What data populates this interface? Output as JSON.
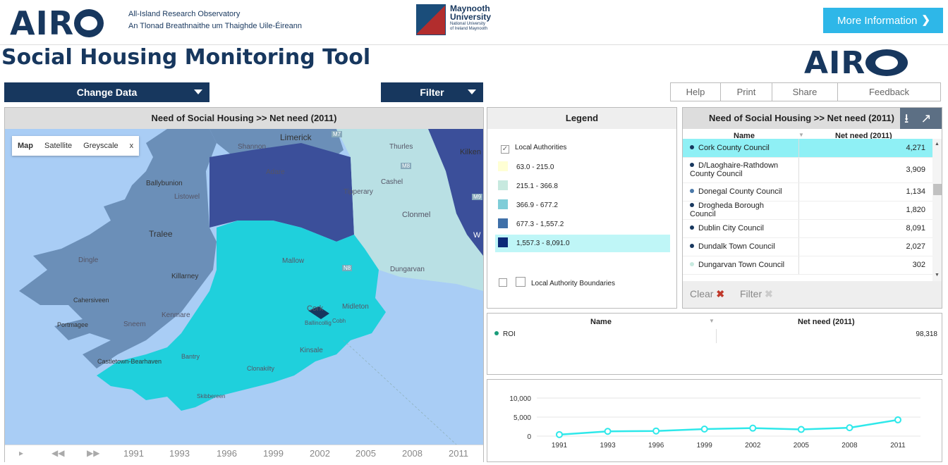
{
  "header": {
    "logo_text": "AIRO",
    "org_line1": "All-Island Research Observatory",
    "org_line2": "An Tlonad Breathnaithe um Thaighde Uile-Éireann",
    "university_name_line1": "Maynooth",
    "university_name_line2": "University",
    "university_sub_line1": "National University",
    "university_sub_line2": "of Ireland Maynooth",
    "more_info_label": "More Information",
    "more_info_icon": "chevron-right-icon"
  },
  "page_title": "Social Housing Monitoring Tool",
  "toolbar": {
    "change_data_label": "Change Data",
    "filter_label": "Filter",
    "help_label": "Help",
    "print_label": "Print",
    "share_label": "Share",
    "feedback_label": "Feedback"
  },
  "map_panel": {
    "title": "Need of Social Housing >>  Net need (2011)",
    "map_types": [
      "Map",
      "Satellite",
      "Greyscale",
      "x"
    ],
    "places": {
      "shannon": "Shannon",
      "limerick": "Limerick",
      "thurles": "Thurles",
      "kilkenny": "Kilken",
      "ballybunion": "Ballybunion",
      "adare": "Adare",
      "listowel": "Listowel",
      "tipperary": "Tipperary",
      "cashel": "Cashel",
      "clonmel": "Clonmel",
      "tralee": "Tralee",
      "dingle": "Dingle",
      "mallow": "Mallow",
      "killarney": "Killarney",
      "dungarvan": "Dungarvan",
      "cahersiveen": "Cahersiveen",
      "kenmare": "Kenmare",
      "cork": "Cork",
      "midleton": "Midleton",
      "portmagee": "Portmagee",
      "sneem": "Sneem",
      "ballincollig": "Ballincollig",
      "cobh": "Cobh",
      "kinsale": "Kinsale",
      "castletown": "Castletown-Bearhaven",
      "bantry": "Bantry",
      "clonakilty": "Clonakilty",
      "skibbereen": "Skibbereen",
      "m8": "M8",
      "m7": "M7",
      "m9": "M9",
      "n8": "N8",
      "w": "W"
    },
    "timeline_years": [
      "1991",
      "1993",
      "1996",
      "1999",
      "2002",
      "2005",
      "2008",
      "2011"
    ],
    "timeline_controls": [
      "play-icon",
      "rewind-icon",
      "fast-forward-icon"
    ]
  },
  "legend": {
    "title": "Legend",
    "local_authorities_label": "Local Authorities",
    "local_authorities_checked": true,
    "classes": [
      {
        "range": "63.0 - 215.0",
        "color": "#ffffd4"
      },
      {
        "range": "215.1 - 366.8",
        "color": "#c7e9df"
      },
      {
        "range": "366.9 - 677.2",
        "color": "#7fcdd8"
      },
      {
        "range": "677.3 - 1,557.2",
        "color": "#3f70a8"
      },
      {
        "range": "1,557.3 - 8,091.0",
        "color": "#0c2a78"
      }
    ],
    "highlighted_class": "1,557.3 - 8,091.0",
    "boundaries_label": "Local Authority Boundaries"
  },
  "data_table": {
    "title": "Need of Social Housing >>  Net need (2011)",
    "columns": [
      "Name",
      "Net need (2011)"
    ],
    "rows": [
      {
        "name": "Cork County Council",
        "value": "4,271",
        "dot": "#17375e",
        "selected": true
      },
      {
        "name": "D/Laoghaire-Rathdown County Council",
        "value": "3,909",
        "dot": "#17375e"
      },
      {
        "name": "Donegal County Council",
        "value": "1,134",
        "dot": "#4a78a8"
      },
      {
        "name": "Drogheda Borough Council",
        "value": "1,820",
        "dot": "#17375e"
      },
      {
        "name": "Dublin City Council",
        "value": "8,091",
        "dot": "#17375e"
      },
      {
        "name": "Dundalk Town Council",
        "value": "2,027",
        "dot": "#17375e"
      },
      {
        "name": "Dungarvan Town Council",
        "value": "302",
        "dot": "#c7e9df"
      }
    ],
    "clear_label": "Clear",
    "filter_label": "Filter"
  },
  "summary_table": {
    "columns": [
      "Name",
      "Net need (2011)"
    ],
    "rows": [
      {
        "name": "ROI",
        "value": "98,318"
      }
    ]
  },
  "chart_data": {
    "type": "line",
    "x": [
      "1991",
      "1993",
      "1996",
      "1999",
      "2002",
      "2005",
      "2008",
      "2011"
    ],
    "series": [
      {
        "values": [
          400,
          1250,
          1350,
          1850,
          2100,
          1750,
          2200,
          4271
        ]
      }
    ],
    "yticks": [
      "10,000",
      "5,000",
      "0"
    ],
    "ylim": [
      0,
      10000
    ],
    "color": "#2ee8ea",
    "grid": true
  }
}
